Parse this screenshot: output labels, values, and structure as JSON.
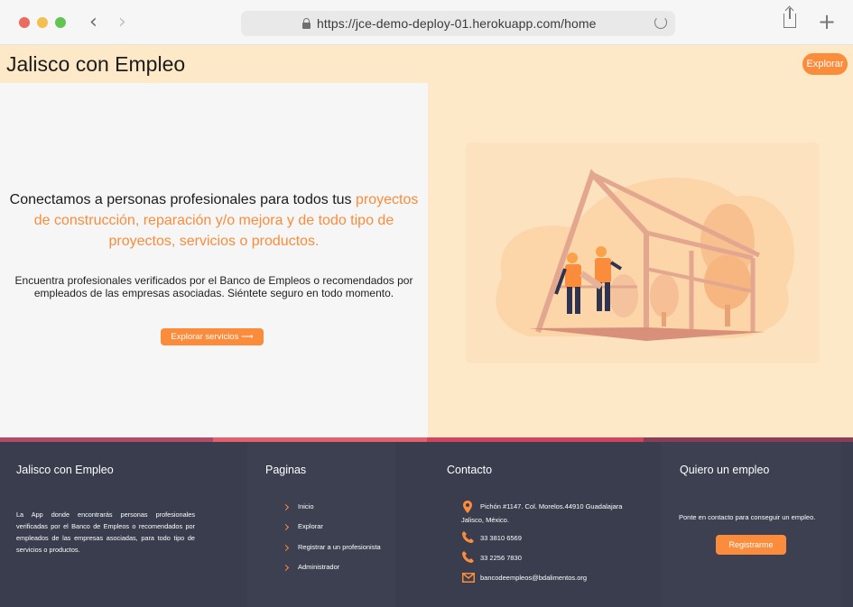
{
  "browser": {
    "url": "https://jce-demo-deploy-01.herokuapp.com/home"
  },
  "header": {
    "brand": "Jalisco con Empleo",
    "explorar_label": "Explorar"
  },
  "hero": {
    "headline_plain": "Conectamos a personas profesionales para todos tus ",
    "headline_highlight": "proyectos de construcción, reparación y/o mejora y de todo tipo de proyectos, servicios o productos.",
    "subtext": "Encuentra profesionales verificados por el Banco de Empleos o recomendados por empleados de las empresas asociadas. Siéntete seguro en todo momento.",
    "cta_label": "Explorar servicios ⟶"
  },
  "footer": {
    "about": {
      "title": "Jalisco con Empleo",
      "text": "La App donde encontrarás personas profesionales verificadas por el Banco de Empleos o recomendados por empleados de las empresas asociadas, para todo tipo de servicios o productos."
    },
    "pages": {
      "title": "Paginas",
      "links": [
        "Inicio",
        "Explorar",
        "Registrar a un profesionista",
        "Administrador"
      ]
    },
    "contact": {
      "title": "Contacto",
      "address_line1": "Pichón #1147. Col. Morelos.44910 Guadalajara",
      "address_line2": "Jalisco, México.",
      "phone1": "33 3810 6569",
      "phone2": "33 2256 7830",
      "email": "bancodeempleos@bdalimentos.org"
    },
    "job": {
      "title": "Quiero un empleo",
      "text": "Ponte en contacto para conseguir un empleo.",
      "button": "Registrarme"
    }
  },
  "colors": {
    "accent": "#fa8c3c",
    "header_bg": "#fde9c8",
    "footer_bg": "#393d4e"
  }
}
